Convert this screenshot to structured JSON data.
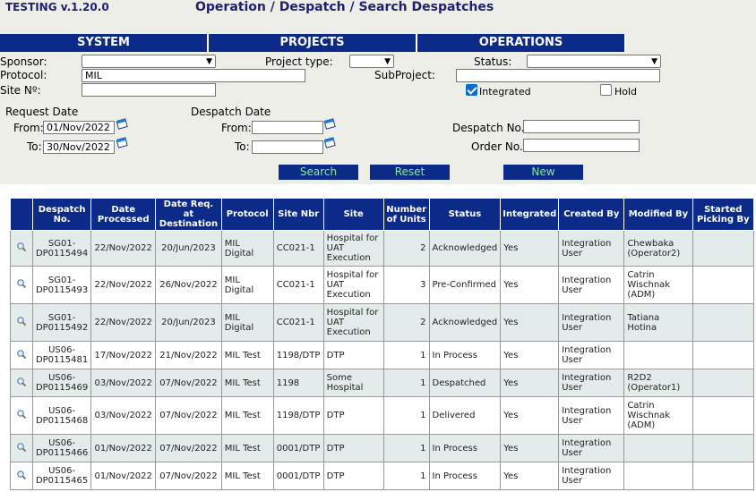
{
  "app": {
    "version": "TESTING v.1.20.0",
    "title": "Operation / Despatch / Search Despatches"
  },
  "nav": [
    "SYSTEM",
    "PROJECTS",
    "OPERATIONS"
  ],
  "form": {
    "sponsor_label": "Sponsor:",
    "project_type_label": "Project type:",
    "status_label": "Status:",
    "protocol_label": "Protocol:",
    "protocol_value": "MIL",
    "subproject_label": "SubProject:",
    "site_label": "Site Nº:",
    "integrated_label": "Integrated",
    "hold_label": "Hold",
    "request_date_label": "Request Date",
    "despatch_date_label": "Despatch Date",
    "from_label": "From:",
    "to_label": "To:",
    "request_from": "01/Nov/2022",
    "request_to": "30/Nov/2022",
    "despatch_no_label": "Despatch No.:",
    "order_no_label": "Order No.:",
    "integrated_checked": true,
    "hold_checked": false
  },
  "buttons": {
    "search": "Search",
    "reset": "Reset",
    "new": "New"
  },
  "table": {
    "headers": [
      "",
      "Despatch No.",
      "Date Processed",
      "Date Req. at Destination",
      "Protocol",
      "Site Nbr",
      "Site",
      "Number of Units",
      "Status",
      "Integrated",
      "Created By",
      "Modified By",
      "Started Picking By"
    ],
    "rows": [
      [
        "SG01-DP0115494",
        "22/Nov/2022",
        "20/Jun/2023",
        "MIL Digital",
        "CC021-1",
        "Hospital for UAT Execution",
        "2",
        "Acknowledged",
        "Yes",
        "Integration User",
        "Chewbaka (Operator2)",
        ""
      ],
      [
        "SG01-DP0115493",
        "22/Nov/2022",
        "26/Nov/2022",
        "MIL Digital",
        "CC021-1",
        "Hospital for UAT Execution",
        "3",
        "Pre-Confirmed",
        "Yes",
        "Integration User",
        "Catrin Wischnak (ADM)",
        ""
      ],
      [
        "SG01-DP0115492",
        "22/Nov/2022",
        "20/Jun/2023",
        "MIL Digital",
        "CC021-1",
        "Hospital for UAT Execution",
        "2",
        "Acknowledged",
        "Yes",
        "Integration User",
        "Tatiana Hotina",
        ""
      ],
      [
        "US06-DP0115481",
        "17/Nov/2022",
        "21/Nov/2022",
        "MIL Test",
        "1198/DTP",
        "DTP",
        "1",
        "In Process",
        "Yes",
        "Integration User",
        "",
        ""
      ],
      [
        "US06-DP0115469",
        "03/Nov/2022",
        "07/Nov/2022",
        "MIL Test",
        "1198",
        "Some Hospital",
        "1",
        "Despatched",
        "Yes",
        "Integration User",
        "R2D2 (Operator1)",
        ""
      ],
      [
        "US06-DP0115468",
        "03/Nov/2022",
        "07/Nov/2022",
        "MIL Test",
        "1198/DTP",
        "DTP",
        "1",
        "Delivered",
        "Yes",
        "Integration User",
        "Catrin Wischnak (ADM)",
        ""
      ],
      [
        "US06-DP0115466",
        "01/Nov/2022",
        "07/Nov/2022",
        "MIL Test",
        "0001/DTP",
        "DTP",
        "1",
        "In Process",
        "Yes",
        "Integration User",
        "",
        ""
      ],
      [
        "US06-DP0115465",
        "01/Nov/2022",
        "07/Nov/2022",
        "MIL Test",
        "0001/DTP",
        "DTP",
        "1",
        "In Process",
        "Yes",
        "Integration User",
        "",
        ""
      ]
    ]
  },
  "icons": {
    "view": "magnifier-icon",
    "calendar": "calendar-icon"
  },
  "colors": {
    "nav_bg": "#0c2a87",
    "button_text": "#86f08d",
    "row_alt": "#e4eceb",
    "panel_bg": "#eeeee8"
  }
}
